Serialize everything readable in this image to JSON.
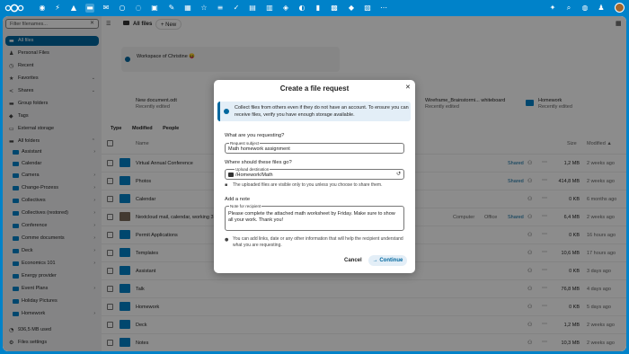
{
  "sidebar": {
    "filter_placeholder": "Filter filenames...",
    "nav": [
      {
        "label": "All files",
        "icon": "folder-icon"
      },
      {
        "label": "Personal Files",
        "icon": "user-icon"
      },
      {
        "label": "Recent",
        "icon": "clock-icon"
      },
      {
        "label": "Favorites",
        "icon": "star-icon"
      },
      {
        "label": "Shares",
        "icon": "share-icon"
      },
      {
        "label": "Group folders",
        "icon": "group-folder-icon"
      },
      {
        "label": "Tags",
        "icon": "tag-icon"
      },
      {
        "label": "External storage",
        "icon": "external-storage-icon"
      },
      {
        "label": "All folders",
        "icon": "folder-icon"
      }
    ],
    "folders": [
      "Assistant",
      "Calendar",
      "Camera",
      "Change-Prozess",
      "Collectives",
      "Collectives (restored)",
      "Conference",
      "Comme documents",
      "Deck",
      "Economics 101",
      "Energy provider",
      "Event Plans",
      "Holiday Pictures",
      "Homework"
    ],
    "storage": "936,5 MB used",
    "settings": "Files settings"
  },
  "main": {
    "breadcrumb": "All files",
    "new_label": "New",
    "workspace_text": "Workspace of Christine 😝",
    "recent": [
      {
        "name": "New document.odt",
        "sub": "Recently edited"
      },
      {
        "name": "Wireframe_Brainstormi... whiteboard",
        "sub": "Recently edited"
      },
      {
        "name": "Homework",
        "sub": "Recently edited"
      }
    ],
    "filters": [
      "Type",
      "Modified",
      "People"
    ],
    "columns": {
      "name": "Name",
      "size": "Size",
      "modified": "Modified ▲"
    },
    "rows": [
      {
        "name": "Virtual Annual Conference",
        "shared": "Shared",
        "size": "1,2 MB",
        "modified": "2 weeks ago"
      },
      {
        "name": "Photos",
        "shared": "Shared",
        "size": "414,8 MB",
        "modified": "2 weeks ago"
      },
      {
        "name": "Calendar",
        "shared": "",
        "size": "0 KB",
        "modified": "6 months ago"
      },
      {
        "name": "Nextcloud mail, calendar, working 3",
        "shared": "Shared",
        "size": "6,4 MB",
        "modified": "2 weeks ago",
        "extra1": "Computer",
        "extra2": "Office"
      },
      {
        "name": "Permit Applications",
        "shared": "",
        "size": "0 KB",
        "modified": "16 hours ago"
      },
      {
        "name": "Templates",
        "shared": "",
        "size": "10,6 MB",
        "modified": "17 hours ago"
      },
      {
        "name": "Assistant",
        "shared": "",
        "size": "0 KB",
        "modified": "3 days ago"
      },
      {
        "name": "Talk",
        "shared": "",
        "size": "76,8 MB",
        "modified": "4 days ago"
      },
      {
        "name": "Homework",
        "shared": "",
        "size": "0 KB",
        "modified": "5 days ago"
      },
      {
        "name": "Deck",
        "shared": "",
        "size": "1,2 MB",
        "modified": "2 weeks ago"
      },
      {
        "name": "Notes",
        "shared": "",
        "size": "10,3 MB",
        "modified": "2 weeks ago"
      }
    ]
  },
  "dialog": {
    "title": "Create a file request",
    "info": "Collect files from others even if they do not have an account. To ensure you can receive files, verify you have enough storage available.",
    "q1": "What are you requesting?",
    "subject_label": "Request subject",
    "subject_value": "Math homework assignment",
    "q2": "Where should these files go?",
    "dest_label": "Upload destination",
    "dest_value": "/Homework/Math",
    "privacy_note": "The uploaded files are visible only to you unless you choose to share them.",
    "q3": "Add a note",
    "note_label": "Note for recipient",
    "note_value": "Please complete the attached math worksheet by Friday. Make sure to show all your work. Thank you!",
    "hint": "You can add links, date or any other information that will help the recipient understand what you are requesting.",
    "cancel": "Cancel",
    "continue": "Continue"
  }
}
